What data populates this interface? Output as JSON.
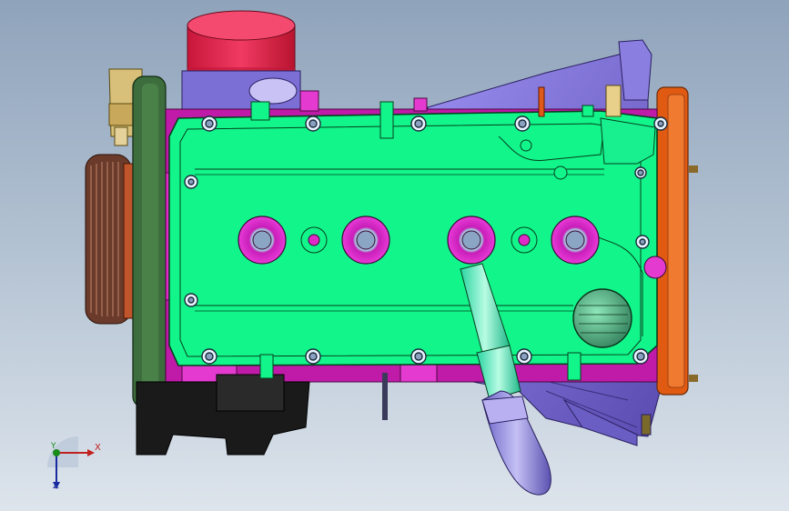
{
  "viewport": {
    "background_top": "#8fa3bb",
    "background_bottom": "#dde4ec"
  },
  "model": {
    "cover_color": "#12f58a",
    "accent_color": "#e01ec8",
    "oil_filter_color": "#e8204a",
    "flywheel_color": "#e05a12",
    "transmission_color": "#7c6bd6",
    "pulley_color": "#3d6d3d"
  },
  "triad": {
    "x_label": "X",
    "y_label": "Y",
    "z_label": "Z",
    "x_color": "#c0201e",
    "y_color": "#1a8a1a",
    "z_color": "#1a2aa0"
  }
}
